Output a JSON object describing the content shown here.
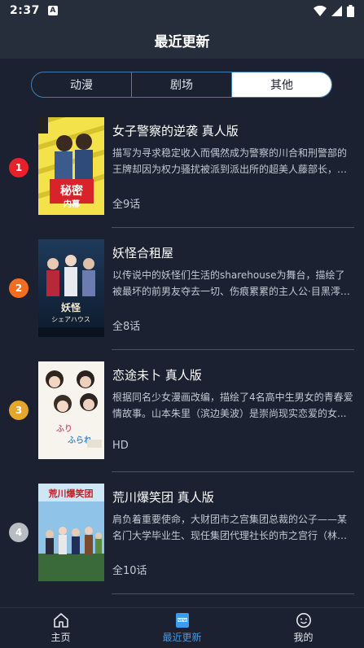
{
  "status": {
    "time": "2:37",
    "notif": "A"
  },
  "header": {
    "title": "最近更新"
  },
  "tabs": [
    {
      "label": "动漫",
      "active": false
    },
    {
      "label": "剧场",
      "active": false
    },
    {
      "label": "其他",
      "active": true
    }
  ],
  "items": [
    {
      "rank": "1",
      "rank_color": "#e8202a",
      "title": "女子警察的逆袭 真人版",
      "desc": "描写为寻求稳定收入而偶然成为警察的川合和刑警部的王牌却因为权力骚扰被派到派出所的超美人藤部长，两...",
      "meta": "全9话",
      "poster_text": "秘密\n内幕"
    },
    {
      "rank": "2",
      "rank_color": "#f36d21",
      "title": "妖怪合租屋",
      "desc": "以传说中的妖怪们生活的sharehouse为舞台，描绘了被最坏的前男友夺去一切、伤痕累累的主人公·目黑澪（...",
      "meta": "全8话",
      "poster_text": "妖怪\nシェアハウス"
    },
    {
      "rank": "3",
      "rank_color": "#e4a72a",
      "title": "恋途未卜 真人版",
      "desc": "根据同名少女漫画改编，描绘了4名高中生男女的青春爱情故事。山本朱里（滨边美波）是崇尚现实恋爱的女...",
      "meta": "HD",
      "poster_text": "ふりふら"
    },
    {
      "rank": "4",
      "rank_color": "#b8bcc3",
      "title": "荒川爆笑团 真人版",
      "desc": "肩负着重要使命，大财团市之宫集团总裁的公子——某名门大学毕业生、现任集团代理社长的市之宫行（林遣...",
      "meta": "全10话",
      "poster_text": "荒川爆笑团"
    }
  ],
  "nav": [
    {
      "label": "主页",
      "icon": "home-icon",
      "active": false
    },
    {
      "label": "最近更新",
      "icon": "new-icon",
      "active": true
    },
    {
      "label": "我的",
      "icon": "profile-icon",
      "active": false
    }
  ]
}
